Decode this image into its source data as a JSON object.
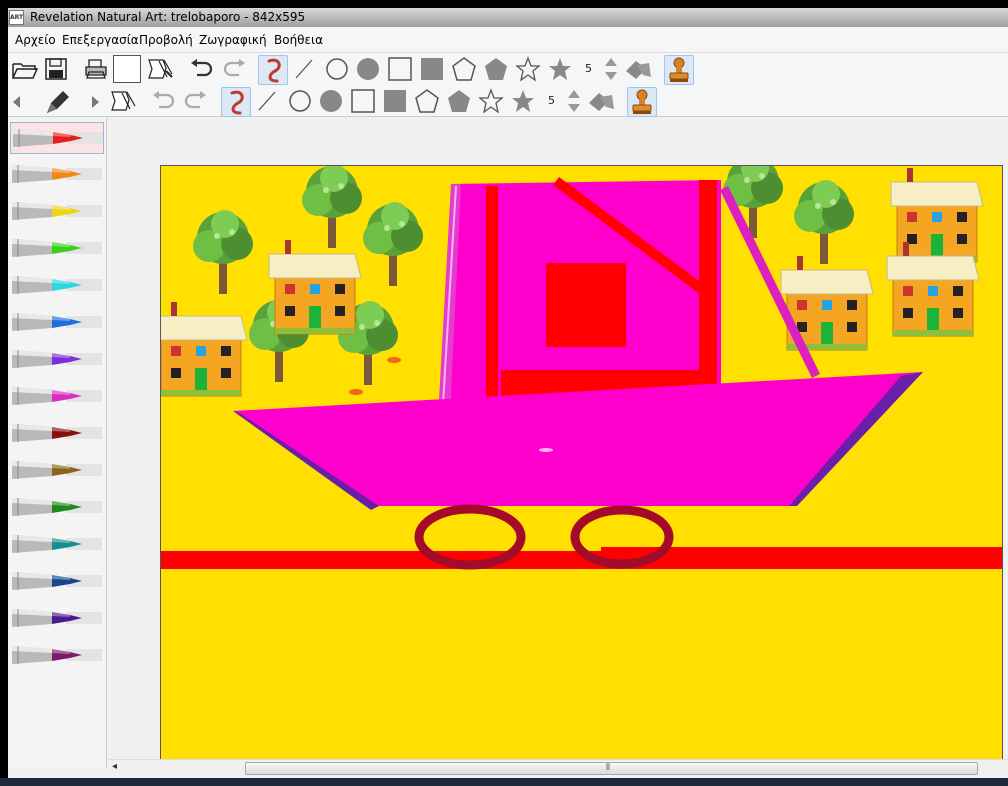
{
  "window": {
    "title": "Revelation Natural Art: trelobaporo - 842x595",
    "icon_text": "ART"
  },
  "menu": [
    "Αρχείο",
    "Επεξεργασία",
    "Προβολή",
    "Ζωγραφική",
    "Βοήθεια"
  ],
  "toolbar1": {
    "brush_size": "5"
  },
  "toolbar2": {
    "brush_size": "5"
  },
  "palette": {
    "selected_index": 0,
    "colors": [
      "#e81c1c",
      "#f08a14",
      "#eed21a",
      "#37d21e",
      "#2fd6e0",
      "#1f6fd8",
      "#7b2fd6",
      "#d82fc0",
      "#8a0e0e",
      "#8a6418",
      "#1e8a1a",
      "#178e8e",
      "#17468e",
      "#4a1a8e",
      "#7e1a6e"
    ]
  },
  "icons": {
    "open": "folder-open-icon",
    "save": "save-icon",
    "print": "printer-icon",
    "new": "blank-page-icon",
    "clear": "eraser-page-icon",
    "undo": "undo-icon",
    "redo": "redo-icon",
    "freehand": "freehand-icon",
    "line": "line-icon",
    "circle": "circle-outline-icon",
    "disc": "circle-filled-icon",
    "rect": "rectangle-outline-icon",
    "rect_filled": "rectangle-filled-icon",
    "pentagon": "pentagon-outline-icon",
    "pentagon_filled": "pentagon-filled-icon",
    "star": "star-outline-icon",
    "star_filled": "star-filled-icon",
    "fill": "fill-bucket-icon",
    "stamp": "stamp-icon"
  }
}
